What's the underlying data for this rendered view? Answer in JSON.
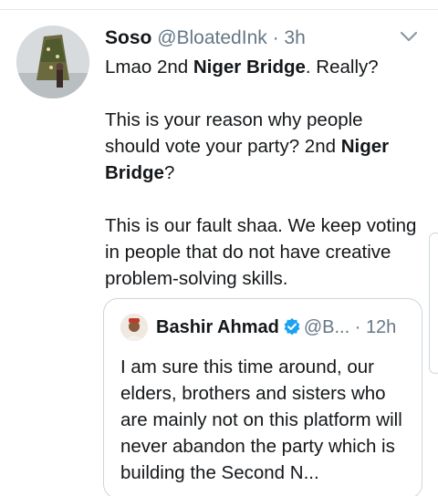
{
  "tweet": {
    "author_name": "Soso",
    "author_handle": "@BloatedInk",
    "separator": " · ",
    "time": "3h",
    "paragraph1": {
      "before": "Lmao 2nd ",
      "bold": "Niger Bridge",
      "after": ". Really?"
    },
    "paragraph2": {
      "before": "This is your reason why people should vote your party? 2nd ",
      "bold": "Niger Bridge",
      "after": "?"
    },
    "paragraph3": "This is our fault shaa. We keep voting in people that do not have creative problem-solving skills.",
    "icons": {
      "avatar": "profile-photo",
      "menu": "chevron-down-icon"
    }
  },
  "quoted_tweet": {
    "author_name": "Bashir Ahmad",
    "author_handle": "@B...",
    "separator": " · ",
    "time": "12h",
    "text": "I am sure this time around, our elders, brothers and sisters who are mainly not on this platform will never abandon the party which is building the Second N...",
    "icons": {
      "avatar": "profile-photo",
      "badge": "verified-badge-icon"
    }
  },
  "colors": {
    "text": "#14171a",
    "secondary": "#657786",
    "verified": "#1da1f2",
    "border": "#ccd6dd"
  }
}
